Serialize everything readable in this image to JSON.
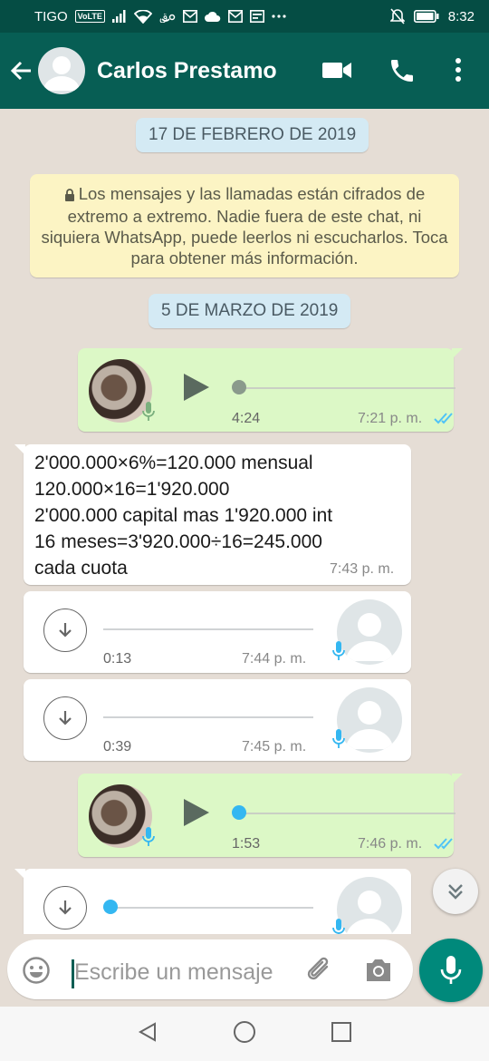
{
  "status_bar": {
    "carrier": "TIGO",
    "volte": "VoLTE",
    "time": "8:32",
    "icons": [
      "signal-icon",
      "wifi-icon",
      "app-icon",
      "email-icon",
      "cloud-icon",
      "email-icon",
      "image-icon",
      "more-dots-icon",
      "mute-icon",
      "battery-icon"
    ]
  },
  "header": {
    "contact_name": "Carlos Prestamo",
    "icons": [
      "back-arrow-icon",
      "avatar-placeholder",
      "video-call-icon",
      "phone-icon",
      "more-vert-icon"
    ]
  },
  "chat": {
    "date_1": "17 DE FEBRERO DE 2019",
    "encryption_notice": "Los mensajes y las llamadas están cifrados de extremo a extremo. Nadie fuera de este chat, ni siquiera WhatsApp, puede leerlos ni escucharlos. Toca para obtener más información.",
    "date_2": "5 DE MARZO DE 2019",
    "messages": [
      {
        "type": "voice",
        "direction": "out",
        "duration": "4:24",
        "time": "7:21 p. m.",
        "progress": 0.0,
        "status": "read"
      },
      {
        "type": "text",
        "direction": "in",
        "text": "2'000.000×6%=120.000 mensual\n120.000×16=1'920.000\n2'000.000 capital mas 1'920.000 int\n16 meses=3'920.000÷16=245.000\ncada cuota",
        "time": "7:43 p. m."
      },
      {
        "type": "voice",
        "direction": "in",
        "duration": "0:13",
        "time": "7:44 p. m.",
        "state": "download"
      },
      {
        "type": "voice",
        "direction": "in",
        "duration": "0:39",
        "time": "7:45 p. m.",
        "state": "download"
      },
      {
        "type": "voice",
        "direction": "out",
        "duration": "1:53",
        "time": "7:46 p. m.",
        "progress": 0.0,
        "status": "read"
      },
      {
        "type": "voice",
        "direction": "in",
        "duration": "",
        "time": "",
        "state": "download",
        "partially_visible": true
      }
    ]
  },
  "composer": {
    "placeholder": "Escribe un mensaje",
    "icons": [
      "emoji-icon",
      "attach-icon",
      "camera-icon",
      "mic-icon"
    ]
  },
  "colors": {
    "header": "#075e54",
    "status_bar": "#054d44",
    "outgoing_bubble": "#dcf8c6",
    "incoming_bubble": "#ffffff",
    "read_ticks": "#4fc3f7",
    "accent_fab": "#00897b",
    "played_knob": "#34b7f1"
  }
}
